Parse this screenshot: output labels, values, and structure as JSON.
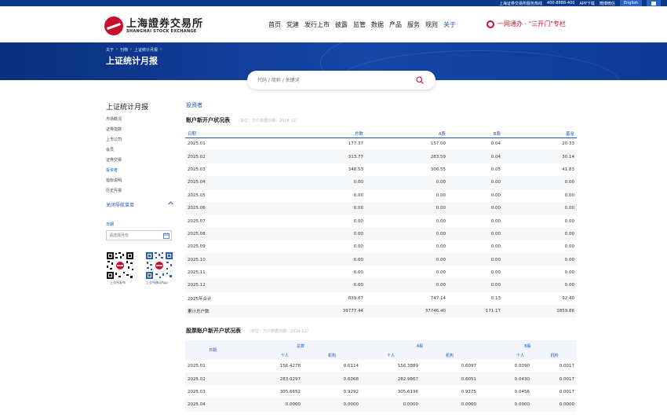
{
  "topbar": {
    "hotline_label": "上海证券交易所服务热线",
    "hotline_number": "400-8888-400",
    "app_label": "APP下载",
    "wechat_label": "微博微信",
    "english_label": "English"
  },
  "header": {
    "logo_cn": "上海證券交易所",
    "logo_en": "SHANGHAI STOCK EXCHANGE",
    "nav": [
      "首页",
      "党建",
      "发行上市",
      "披露",
      "监管",
      "数据",
      "产品",
      "服务",
      "规则",
      "关于"
    ],
    "active_nav": "关于",
    "promo": "一网通办 · \"三开门\"专栏"
  },
  "banner": {
    "breadcrumb": [
      "关于",
      "刊物",
      "上证统计月报"
    ],
    "title": "上证统计月报"
  },
  "search": {
    "placeholder": "代码 / 简称 / 关键词"
  },
  "sidebar": {
    "title": "上证统计月报",
    "items": [
      "市场概况",
      "证券指数",
      "上市公司",
      "会员",
      "证券交易",
      "投资者",
      "指标说明",
      "历史月报"
    ],
    "active_item": "投资者",
    "toggle_label": "关闭导航菜单",
    "date_label": "日期",
    "date_placeholder": "请选择月份",
    "qr1_caption": "上交所发布",
    "qr2_caption": "上交所移动App"
  },
  "content": {
    "section_label": "投资者",
    "table1": {
      "title": "账户新开户状况表",
      "note": "（单位：万户数据日期：2024-12）",
      "headers": [
        "日期",
        "总数",
        "A股",
        "B股",
        "基金"
      ],
      "rows": [
        [
          "2025.01",
          "177.37",
          "157.00",
          "0.04",
          "20.33"
        ],
        [
          "2025.02",
          "313.77",
          "283.59",
          "0.04",
          "30.14"
        ],
        [
          "2025.03",
          "348.53",
          "306.55",
          "0.05",
          "41.83"
        ],
        [
          "2025.04",
          "0.00",
          "0.00",
          "0.00",
          "0.00"
        ],
        [
          "2025.05",
          "0.00",
          "0.00",
          "0.00",
          "0.00"
        ],
        [
          "2025.06",
          "0.00",
          "0.00",
          "0.00",
          "0.00"
        ],
        [
          "2025.07",
          "0.00",
          "0.00",
          "0.00",
          "0.00"
        ],
        [
          "2025.08",
          "0.00",
          "0.00",
          "0.00",
          "0.00"
        ],
        [
          "2025.09",
          "0.00",
          "0.00",
          "0.00",
          "0.00"
        ],
        [
          "2025.10",
          "0.00",
          "0.00",
          "0.00",
          "0.00"
        ],
        [
          "2025.11",
          "0.00",
          "0.00",
          "0.00",
          "0.00"
        ],
        [
          "2025.12",
          "0.00",
          "0.00",
          "0.00",
          "0.00"
        ],
        [
          "2025年合计",
          "839.67",
          "747.14",
          "0.13",
          "92.40"
        ],
        [
          "累计总户数",
          "39777.44",
          "37746.40",
          "171.17",
          "1859.86"
        ]
      ]
    },
    "table2": {
      "title": "股票账户新开户状况表",
      "note": "（单位：万户数据日期：2024-12）",
      "date_header": "日期",
      "group_headers": [
        "总数",
        "A股",
        "B股"
      ],
      "sub_headers": [
        "个人",
        "机构",
        "个人",
        "机构",
        "个人",
        "机构"
      ],
      "rows": [
        [
          "2025.01",
          "156.4278",
          "0.6114",
          "156.3889",
          "0.6097",
          "0.0390",
          "0.0017"
        ],
        [
          "2025.02",
          "283.0297",
          "0.6068",
          "282.9867",
          "0.6051",
          "0.0430",
          "0.0017"
        ],
        [
          "2025.03",
          "305.6652",
          "0.9292",
          "305.6196",
          "0.9275",
          "0.0456",
          "0.0017"
        ],
        [
          "2025.04",
          "0.0000",
          "0.0000",
          "0.0000",
          "0.0000",
          "0.0000",
          "0.0000"
        ]
      ]
    }
  }
}
